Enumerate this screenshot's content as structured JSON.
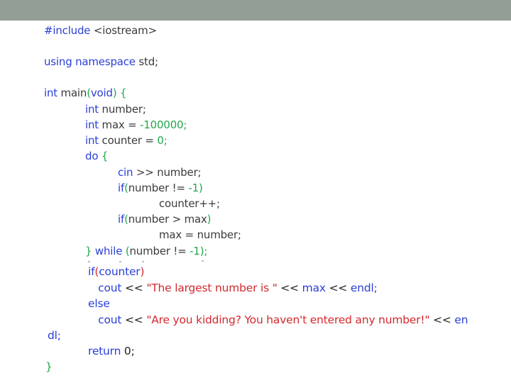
{
  "code": {
    "top": [
      {
        "indent": 0,
        "tokens": [
          {
            "c": "k",
            "t": "#include "
          },
          {
            "c": "t",
            "t": "<iostream>"
          }
        ]
      },
      {
        "indent": 0,
        "tokens": [
          {
            "c": "k",
            "t": "using namespace "
          },
          {
            "c": "t",
            "t": "std;"
          }
        ]
      },
      {
        "indent": 0,
        "tokens": [
          {
            "c": "k",
            "t": "int "
          },
          {
            "c": "t",
            "t": "main"
          },
          {
            "c": "g",
            "t": "("
          },
          {
            "c": "k",
            "t": "void"
          },
          {
            "c": "g",
            "t": ") {"
          }
        ]
      },
      {
        "indent": 1,
        "tokens": [
          {
            "c": "k",
            "t": "int "
          },
          {
            "c": "t",
            "t": "number;"
          }
        ]
      },
      {
        "indent": 1,
        "tokens": [
          {
            "c": "k",
            "t": "int "
          },
          {
            "c": "t",
            "t": "max = "
          },
          {
            "c": "g",
            "t": "-100000;"
          }
        ]
      },
      {
        "indent": 1,
        "tokens": [
          {
            "c": "k",
            "t": "int "
          },
          {
            "c": "t",
            "t": "counter = "
          },
          {
            "c": "g",
            "t": "0;"
          }
        ]
      },
      {
        "indent": 1,
        "tokens": [
          {
            "c": "k",
            "t": "do "
          },
          {
            "c": "g",
            "t": "{"
          }
        ]
      },
      {
        "indent": 2,
        "tokens": [
          {
            "c": "k",
            "t": "cin "
          },
          {
            "c": "t",
            "t": ">> number;"
          }
        ]
      },
      {
        "indent": 2,
        "tokens": [
          {
            "c": "k",
            "t": "if"
          },
          {
            "c": "g",
            "t": "("
          },
          {
            "c": "t",
            "t": "number != "
          },
          {
            "c": "g",
            "t": "-1)"
          }
        ]
      },
      {
        "indent": 3,
        "tokens": [
          {
            "c": "t",
            "t": "counter++;"
          }
        ]
      },
      {
        "indent": 2,
        "tokens": [
          {
            "c": "k",
            "t": "if"
          },
          {
            "c": "g",
            "t": "("
          },
          {
            "c": "t",
            "t": "number > max"
          },
          {
            "c": "g",
            "t": ")"
          }
        ]
      },
      {
        "indent": 3,
        "tokens": [
          {
            "c": "t",
            "t": "max = number;"
          }
        ]
      },
      {
        "indent": 1,
        "tokens": [
          {
            "c": "g",
            "t": "} "
          },
          {
            "c": "k",
            "t": "while "
          },
          {
            "c": "g",
            "t": "("
          },
          {
            "c": "t",
            "t": "number != "
          },
          {
            "c": "g",
            "t": "-1);"
          }
        ]
      }
    ],
    "bottom": [
      {
        "tokens": [
          {
            "c": "k",
            "t": "if"
          },
          {
            "c": "s",
            "t": "("
          },
          {
            "c": "k",
            "t": "counter"
          },
          {
            "c": "s",
            "t": ")"
          }
        ]
      },
      {
        "tokens": [
          {
            "c": "k",
            "t": "   cout "
          },
          {
            "c": "f",
            "t": "<< "
          },
          {
            "c": "s",
            "t": "\"The largest number is \""
          },
          {
            "c": "f",
            "t": " << "
          },
          {
            "c": "k",
            "t": "max "
          },
          {
            "c": "f",
            "t": "<< "
          },
          {
            "c": "k",
            "t": "endl;"
          }
        ]
      },
      {
        "tokens": [
          {
            "c": "k",
            "t": "else"
          }
        ]
      },
      {
        "tokens": [
          {
            "c": "k",
            "t": "   cout "
          },
          {
            "c": "f",
            "t": "<< "
          },
          {
            "c": "s",
            "t": "\"Are you kidding? You haven't entered any number!\""
          },
          {
            "c": "f",
            "t": " << "
          },
          {
            "c": "k",
            "t": "en"
          }
        ]
      },
      {
        "tokens": [
          {
            "c": "k",
            "t": "dl;"
          }
        ]
      },
      {
        "tokens": [
          {
            "c": "k",
            "t": "return "
          },
          {
            "c": "f",
            "t": "0;"
          }
        ]
      },
      {
        "tokens": [
          {
            "c": "g",
            "t": "}"
          }
        ]
      }
    ]
  }
}
